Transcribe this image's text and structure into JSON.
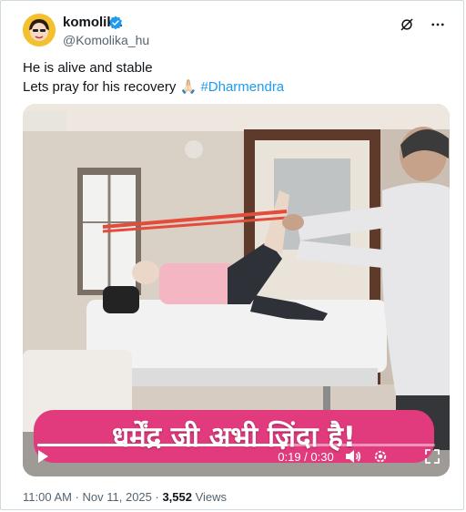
{
  "author": {
    "display_name": "komolika",
    "handle": "@Komolika_hu"
  },
  "icons": {
    "verified": "verified-badge-icon",
    "grok": "grok-icon",
    "more": "more-icon",
    "play": "play-icon",
    "volume": "volume-icon",
    "settings": "settings-icon",
    "fullscreen": "fullscreen-icon"
  },
  "post": {
    "line1": "He is alive and stable",
    "line2": "Lets pray for his recovery",
    "emoji": "🙏🏻",
    "hashtag": "#Dharmendra"
  },
  "video": {
    "caption": "धर्मेंद्र जी अभी ज़िंदा है!",
    "time": "0:19 / 0:30",
    "progress": 0.63
  },
  "meta": {
    "time_date": "11:00 AM · Nov 11, 2025 · ",
    "views_count": "3,552",
    "views_label": " Views"
  },
  "colors": {
    "accent": "#1d9bf0",
    "verified": "#1d9bf0",
    "caption_bg": "#e23b7d"
  }
}
